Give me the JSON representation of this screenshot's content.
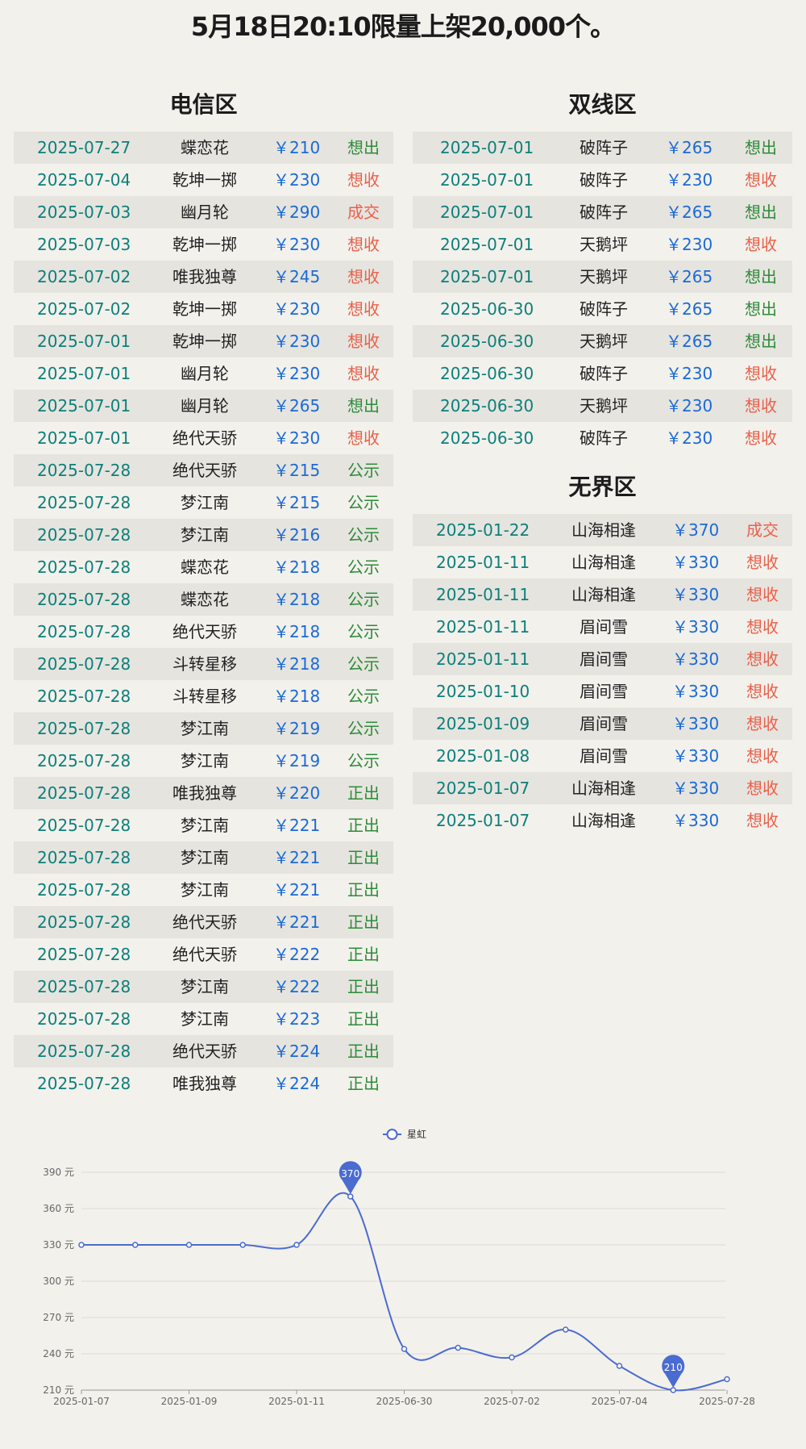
{
  "headline": "5月18日20:10限量上架20,000个。",
  "sections": {
    "dianxin": {
      "title": "电信区",
      "rows": [
        {
          "date": "2025-07-27",
          "name": "蝶恋花",
          "price": "￥210",
          "status": "想出"
        },
        {
          "date": "2025-07-04",
          "name": "乾坤一掷",
          "price": "￥230",
          "status": "想收"
        },
        {
          "date": "2025-07-03",
          "name": "幽月轮",
          "price": "￥290",
          "status": "成交"
        },
        {
          "date": "2025-07-03",
          "name": "乾坤一掷",
          "price": "￥230",
          "status": "想收"
        },
        {
          "date": "2025-07-02",
          "name": "唯我独尊",
          "price": "￥245",
          "status": "想收"
        },
        {
          "date": "2025-07-02",
          "name": "乾坤一掷",
          "price": "￥230",
          "status": "想收"
        },
        {
          "date": "2025-07-01",
          "name": "乾坤一掷",
          "price": "￥230",
          "status": "想收"
        },
        {
          "date": "2025-07-01",
          "name": "幽月轮",
          "price": "￥230",
          "status": "想收"
        },
        {
          "date": "2025-07-01",
          "name": "幽月轮",
          "price": "￥265",
          "status": "想出"
        },
        {
          "date": "2025-07-01",
          "name": "绝代天骄",
          "price": "￥230",
          "status": "想收"
        },
        {
          "date": "2025-07-28",
          "name": "绝代天骄",
          "price": "￥215",
          "status": "公示"
        },
        {
          "date": "2025-07-28",
          "name": "梦江南",
          "price": "￥215",
          "status": "公示"
        },
        {
          "date": "2025-07-28",
          "name": "梦江南",
          "price": "￥216",
          "status": "公示"
        },
        {
          "date": "2025-07-28",
          "name": "蝶恋花",
          "price": "￥218",
          "status": "公示"
        },
        {
          "date": "2025-07-28",
          "name": "蝶恋花",
          "price": "￥218",
          "status": "公示"
        },
        {
          "date": "2025-07-28",
          "name": "绝代天骄",
          "price": "￥218",
          "status": "公示"
        },
        {
          "date": "2025-07-28",
          "name": "斗转星移",
          "price": "￥218",
          "status": "公示"
        },
        {
          "date": "2025-07-28",
          "name": "斗转星移",
          "price": "￥218",
          "status": "公示"
        },
        {
          "date": "2025-07-28",
          "name": "梦江南",
          "price": "￥219",
          "status": "公示"
        },
        {
          "date": "2025-07-28",
          "name": "梦江南",
          "price": "￥219",
          "status": "公示"
        },
        {
          "date": "2025-07-28",
          "name": "唯我独尊",
          "price": "￥220",
          "status": "正出"
        },
        {
          "date": "2025-07-28",
          "name": "梦江南",
          "price": "￥221",
          "status": "正出"
        },
        {
          "date": "2025-07-28",
          "name": "梦江南",
          "price": "￥221",
          "status": "正出"
        },
        {
          "date": "2025-07-28",
          "name": "梦江南",
          "price": "￥221",
          "status": "正出"
        },
        {
          "date": "2025-07-28",
          "name": "绝代天骄",
          "price": "￥221",
          "status": "正出"
        },
        {
          "date": "2025-07-28",
          "name": "绝代天骄",
          "price": "￥222",
          "status": "正出"
        },
        {
          "date": "2025-07-28",
          "name": "梦江南",
          "price": "￥222",
          "status": "正出"
        },
        {
          "date": "2025-07-28",
          "name": "梦江南",
          "price": "￥223",
          "status": "正出"
        },
        {
          "date": "2025-07-28",
          "name": "绝代天骄",
          "price": "￥224",
          "status": "正出"
        },
        {
          "date": "2025-07-28",
          "name": "唯我独尊",
          "price": "￥224",
          "status": "正出"
        }
      ]
    },
    "shuangxian": {
      "title": "双线区",
      "rows": [
        {
          "date": "2025-07-01",
          "name": "破阵子",
          "price": "￥265",
          "status": "想出"
        },
        {
          "date": "2025-07-01",
          "name": "破阵子",
          "price": "￥230",
          "status": "想收"
        },
        {
          "date": "2025-07-01",
          "name": "破阵子",
          "price": "￥265",
          "status": "想出"
        },
        {
          "date": "2025-07-01",
          "name": "天鹅坪",
          "price": "￥230",
          "status": "想收"
        },
        {
          "date": "2025-07-01",
          "name": "天鹅坪",
          "price": "￥265",
          "status": "想出"
        },
        {
          "date": "2025-06-30",
          "name": "破阵子",
          "price": "￥265",
          "status": "想出"
        },
        {
          "date": "2025-06-30",
          "name": "天鹅坪",
          "price": "￥265",
          "status": "想出"
        },
        {
          "date": "2025-06-30",
          "name": "破阵子",
          "price": "￥230",
          "status": "想收"
        },
        {
          "date": "2025-06-30",
          "name": "天鹅坪",
          "price": "￥230",
          "status": "想收"
        },
        {
          "date": "2025-06-30",
          "name": "破阵子",
          "price": "￥230",
          "status": "想收"
        }
      ]
    },
    "wujie": {
      "title": "无界区",
      "rows": [
        {
          "date": "2025-01-22",
          "name": "山海相逢",
          "price": "￥370",
          "status": "成交"
        },
        {
          "date": "2025-01-11",
          "name": "山海相逢",
          "price": "￥330",
          "status": "想收"
        },
        {
          "date": "2025-01-11",
          "name": "山海相逢",
          "price": "￥330",
          "status": "想收"
        },
        {
          "date": "2025-01-11",
          "name": "眉间雪",
          "price": "￥330",
          "status": "想收"
        },
        {
          "date": "2025-01-11",
          "name": "眉间雪",
          "price": "￥330",
          "status": "想收"
        },
        {
          "date": "2025-01-10",
          "name": "眉间雪",
          "price": "￥330",
          "status": "想收"
        },
        {
          "date": "2025-01-09",
          "name": "眉间雪",
          "price": "￥330",
          "status": "想收"
        },
        {
          "date": "2025-01-08",
          "name": "眉间雪",
          "price": "￥330",
          "status": "想收"
        },
        {
          "date": "2025-01-07",
          "name": "山海相逢",
          "price": "￥330",
          "status": "想收"
        },
        {
          "date": "2025-01-07",
          "name": "山海相逢",
          "price": "￥330",
          "status": "想收"
        }
      ]
    }
  },
  "status_colors": {
    "想出": "#2e8b3a",
    "想收": "#e8604a",
    "成交": "#e8604a",
    "公示": "#2e8b3a",
    "正出": "#2e8b3a"
  },
  "chart_data": {
    "type": "line",
    "legend": "星虹",
    "legend_position": "top-center",
    "series_color": "#4a6bd0",
    "x": [
      "2025-01-07",
      "2025-01-08",
      "2025-01-09",
      "2025-01-10",
      "2025-01-11",
      "2025-01-22",
      "2025-06-30",
      "2025-07-01",
      "2025-07-02",
      "2025-07-03",
      "2025-07-04",
      "2025-07-27",
      "2025-07-28"
    ],
    "x_tick_labels": [
      "2025-01-07",
      "2025-01-09",
      "2025-01-11",
      "2025-06-30",
      "2025-07-02",
      "2025-07-04",
      "2025-07-28"
    ],
    "values": [
      330,
      330,
      330,
      330,
      330,
      370,
      244,
      245,
      237,
      260,
      230,
      210,
      219
    ],
    "y_ticks": [
      "210 元",
      "240 元",
      "270 元",
      "300 元",
      "330 元",
      "360 元",
      "390 元"
    ],
    "ylim": [
      210,
      390
    ],
    "grid": true,
    "max_marker": "370",
    "min_marker": "210"
  }
}
